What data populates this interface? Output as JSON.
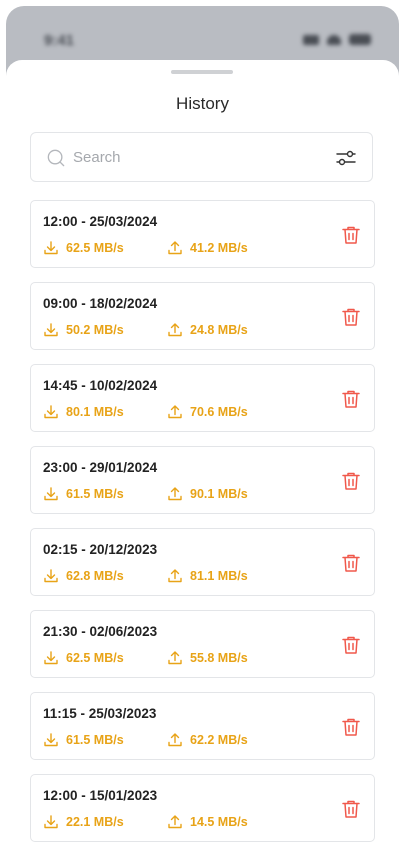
{
  "status_bar": {
    "time": "9:41"
  },
  "sheet": {
    "title": "History"
  },
  "search": {
    "placeholder": "Search"
  },
  "colors": {
    "accent": "#e8a317",
    "delete": "#f0584b",
    "border": "#e3e5e8"
  },
  "history": [
    {
      "datetime": "12:00 - 25/03/2024",
      "download": "62.5 MB/s",
      "upload": "41.2 MB/s"
    },
    {
      "datetime": "09:00 - 18/02/2024",
      "download": "50.2 MB/s",
      "upload": "24.8 MB/s"
    },
    {
      "datetime": "14:45 - 10/02/2024",
      "download": "80.1 MB/s",
      "upload": "70.6 MB/s"
    },
    {
      "datetime": "23:00 - 29/01/2024",
      "download": "61.5 MB/s",
      "upload": "90.1 MB/s"
    },
    {
      "datetime": "02:15 - 20/12/2023",
      "download": "62.8 MB/s",
      "upload": "81.1 MB/s"
    },
    {
      "datetime": "21:30 - 02/06/2023",
      "download": "62.5 MB/s",
      "upload": "55.8 MB/s"
    },
    {
      "datetime": "11:15 - 25/03/2023",
      "download": "61.5 MB/s",
      "upload": "62.2 MB/s"
    },
    {
      "datetime": "12:00 - 15/01/2023",
      "download": "22.1 MB/s",
      "upload": "14.5 MB/s"
    }
  ]
}
